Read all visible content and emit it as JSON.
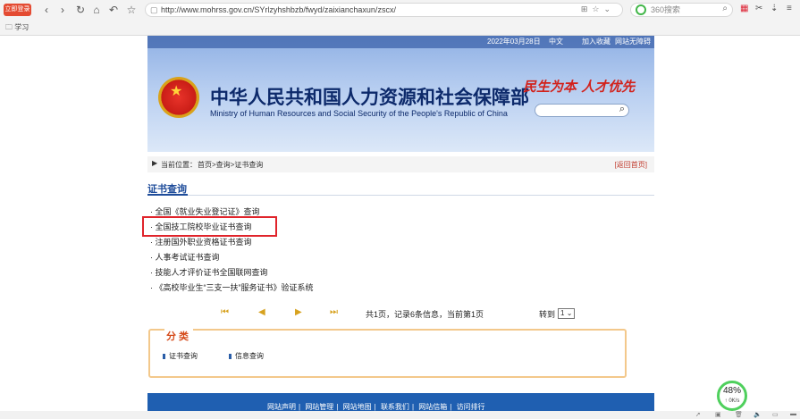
{
  "browser": {
    "badge": "立即登录",
    "url": "http://www.mohrss.gov.cn/SYrlzyhshbzb/fwyd/zaixianchaxun/zscx/",
    "search_placeholder": "360搜索",
    "bookmark": "学习"
  },
  "header": {
    "date": "2022年03月28日",
    "lang": "中文",
    "favorite": "加入收藏",
    "nav": "网站无障碍",
    "title_cn": "中华人民共和国人力资源和社会保障部",
    "title_en": "Ministry of Human Resources and Social Security of the People's Republic of China",
    "slogan": "民生为本 人才优先"
  },
  "breadcrumb": {
    "label": "当前位置：",
    "path": "首页>查询>证书查询",
    "back": "[返回首页]"
  },
  "section": {
    "title": "证书查询",
    "items": [
      "· 全国《就业失业登记证》查询",
      "· 全国技工院校毕业证书查询",
      "· 注册国外职业资格证书查询",
      "· 人事考试证书查询",
      "· 技能人才评价证书全国联网查询",
      "· 《高校毕业生“三支一扶”服务证书》验证系统"
    ]
  },
  "pager": {
    "info": "共1页，记录6条信息，当前第1页",
    "goto": "转到",
    "page": "1"
  },
  "category": {
    "title": "分类",
    "items": [
      "证书查询",
      "信息查询"
    ]
  },
  "footer": {
    "links": [
      "网站声明",
      "网站管理",
      "网站地图",
      "联系我们",
      "网站信箱",
      "访问排行"
    ],
    "separator": "|"
  },
  "speed": {
    "percent": "48%",
    "rate": "↑ 0K/s"
  }
}
